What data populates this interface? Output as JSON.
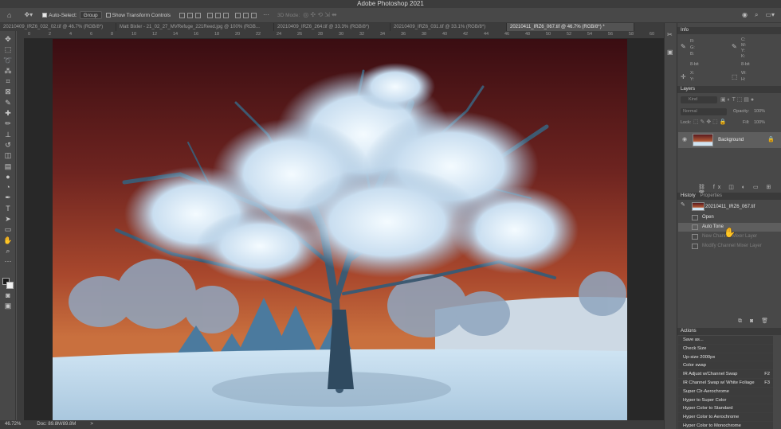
{
  "window": {
    "title": "Adobe Photoshop 2021"
  },
  "options_bar": {
    "auto_select_label": "Auto-Select:",
    "auto_select_value": "Group",
    "transform_controls_label": "Show Transform Controls",
    "mode_3d_label": "3D Mode:"
  },
  "tabs": [
    {
      "label": "20210409_IRZ6_032_02.tif @ 46.7% (RGB/8*)",
      "active": false
    },
    {
      "label": "Matt Bixler - 21_02_27_MVRefuge_221Reed.jpg @ 100% (RGB...",
      "active": false
    },
    {
      "label": "20210409_IRZ6_264.tif @ 33.3% (RGB/8*)",
      "active": false
    },
    {
      "label": "20210409_IRZ6_031.tif @ 33.1% (RGB/8*)",
      "active": false
    },
    {
      "label": "20210411_IRZ6_067.tif @ 46.7% (RGB/8*) *",
      "active": true
    }
  ],
  "ruler_ticks": [
    "0",
    "2",
    "4",
    "6",
    "8",
    "10",
    "12",
    "14",
    "16",
    "18",
    "20",
    "22",
    "24",
    "26",
    "28",
    "30",
    "32",
    "34",
    "36",
    "38",
    "40",
    "42",
    "44",
    "46",
    "48",
    "50",
    "52",
    "54",
    "56",
    "58",
    "60"
  ],
  "status": {
    "zoom": "46.72%",
    "doc": "Doc: 89.8M/89.8M",
    "arrow": ">"
  },
  "info_panel": {
    "title": "Info",
    "labels_left": [
      "R:",
      "G:",
      "B:"
    ],
    "labels_right": [
      "C:",
      "M:",
      "Y:",
      "K:"
    ],
    "bit_left": "8-bit",
    "bit_right": "8-bit",
    "x_label": "X:",
    "y_label": "Y:",
    "w_label": "W:",
    "h_label": "H:"
  },
  "layers_panel": {
    "title": "Layers",
    "kind_label": "Kind",
    "blend_mode": "Normal",
    "opacity_label": "Opacity:",
    "opacity_value": "100%",
    "lock_label": "Lock:",
    "fill_label": "Fill:",
    "fill_value": "100%",
    "layers": [
      {
        "name": "Background",
        "locked": true,
        "visible": true
      }
    ]
  },
  "history_panel": {
    "tabs": [
      "History",
      "Properties"
    ],
    "snapshot": "20210411_IRZ6_067.tif",
    "states": [
      {
        "label": "Open",
        "state": "normal"
      },
      {
        "label": "Auto Tone",
        "state": "selected"
      },
      {
        "label": "New Channel Mixer Layer",
        "state": "undone"
      },
      {
        "label": "Modify Channel Mixer Layer",
        "state": "undone"
      }
    ]
  },
  "actions_panel": {
    "title": "Actions",
    "items": [
      {
        "label": "Save as...",
        "key": ""
      },
      {
        "label": "Check Size",
        "key": ""
      },
      {
        "label": "Up-size 2000px",
        "key": ""
      },
      {
        "label": "Color swap",
        "key": ""
      },
      {
        "label": "IR Adjust w/Channel Swap",
        "key": "F2"
      },
      {
        "label": "IR Channel Swap w/ White Foliage",
        "key": "F3"
      },
      {
        "label": "Super Clr-Aerochrome",
        "key": ""
      },
      {
        "label": "Hyper to Super Color",
        "key": ""
      },
      {
        "label": "Hyper Color to Standard",
        "key": ""
      },
      {
        "label": "Hyper Color to Aerochrome",
        "key": ""
      },
      {
        "label": "Hyper Color to Monochrome",
        "key": ""
      }
    ]
  },
  "colors": {
    "accent": "#535353",
    "selected": "#5e5e5e",
    "sky_top": "#3a0d12",
    "sky_bottom": "#c9703e",
    "frost": "#e4f2ff"
  }
}
